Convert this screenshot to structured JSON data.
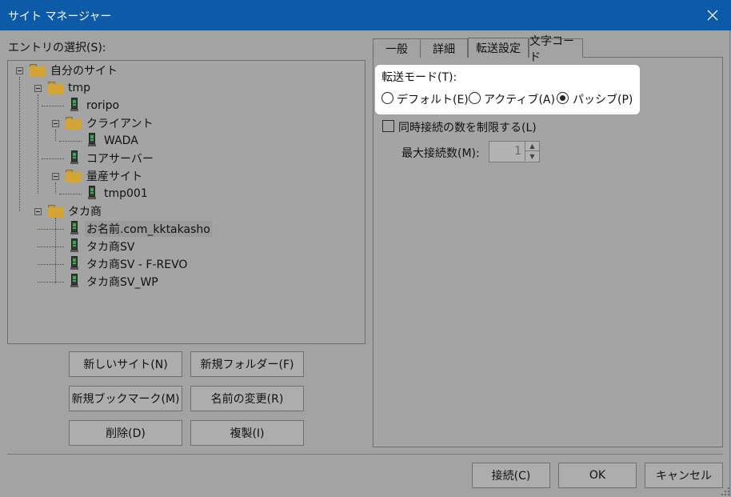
{
  "window": {
    "title": "サイト マネージャー"
  },
  "entries_label": "エントリの選択(S):",
  "tree": {
    "root": "自分のサイト",
    "items": [
      {
        "label": "tmp"
      },
      {
        "label": "roripo"
      },
      {
        "label": "クライアント"
      },
      {
        "label": "WADA"
      },
      {
        "label": "コアサーバー"
      },
      {
        "label": "量産サイト"
      },
      {
        "label": "tmp001"
      },
      {
        "label": "タカ商"
      },
      {
        "label": "お名前.com_kktakasho"
      },
      {
        "label": "タカ商SV"
      },
      {
        "label": "タカ商SV - F-REVO"
      },
      {
        "label": "タカ商SV_WP"
      }
    ]
  },
  "buttons": {
    "new_site": "新しいサイト(N)",
    "new_folder": "新規フォルダー(F)",
    "new_bookmark": "新規ブックマーク(M)",
    "rename": "名前の変更(R)",
    "delete": "削除(D)",
    "duplicate": "複製(I)",
    "connect": "接続(C)",
    "ok": "OK",
    "cancel": "キャンセル"
  },
  "tabs": [
    {
      "label": "一般"
    },
    {
      "label": "詳細"
    },
    {
      "label": "転送設定"
    },
    {
      "label": "文字コード"
    }
  ],
  "active_tab": "転送設定",
  "transfer": {
    "mode_label": "転送モード(T):",
    "modes": [
      {
        "label": "デフォルト(E)",
        "selected": false
      },
      {
        "label": "アクティブ(A)",
        "selected": false
      },
      {
        "label": "パッシブ(P)",
        "selected": true
      }
    ],
    "limit_label": "同時接続の数を制限する(L)",
    "limit_checked": false,
    "max_label": "最大接続数(M):",
    "max_value": "1"
  }
}
